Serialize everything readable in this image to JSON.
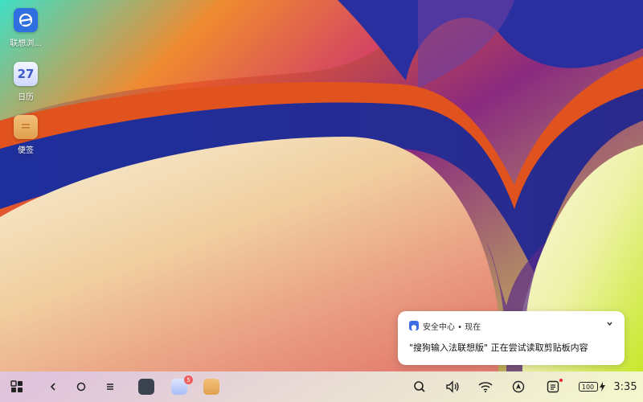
{
  "desktop": {
    "icons": [
      {
        "label": "联想浏...",
        "icon": "browser-icon"
      },
      {
        "label": "日历",
        "icon": "calendar-icon",
        "day": "27"
      },
      {
        "label": "便签",
        "icon": "notes-icon"
      }
    ]
  },
  "notification": {
    "header": "安全中心 • 现在",
    "body": "\"搜狗输入法联想版\" 正在尝试读取剪贴板内容",
    "app_icon": "security-center-icon",
    "expand_icon": "chevron-down-icon"
  },
  "taskbar": {
    "pinned_apps": [
      {
        "name": "app-1",
        "icon": "dark-app-icon"
      },
      {
        "name": "app-2",
        "icon": "messages-icon",
        "badge": "5"
      },
      {
        "name": "app-3",
        "icon": "notes-app-icon"
      }
    ],
    "battery": "100",
    "time": "3:35"
  },
  "colors": {
    "accent": "#2f6fe0",
    "badge": "#f06060"
  }
}
